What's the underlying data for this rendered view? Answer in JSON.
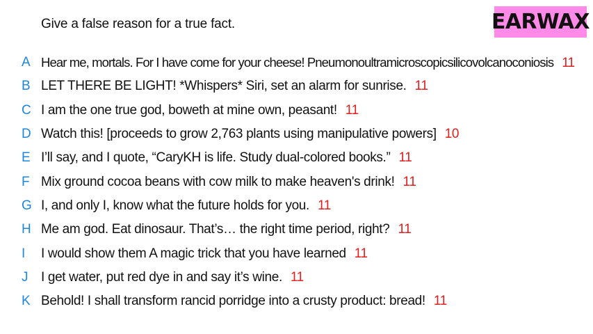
{
  "prompt": "Give a false reason for a true fact.",
  "logo": "EARWAX",
  "colors": {
    "letter": "#1d86e0",
    "score": "#e01f1f",
    "logo_bg": "#ff8ae8",
    "text": "#111111"
  },
  "answers": [
    {
      "letter": "A",
      "text": "Hear me, mortals. For I have come for your cheese! Pneumonoultramicroscopicsilicovolcanoconiosis",
      "score": "11"
    },
    {
      "letter": "B",
      "text": "LET THERE BE LIGHT! *Whispers* Siri, set an alarm for sunrise.",
      "score": "11"
    },
    {
      "letter": "C",
      "text": "I am the one true god, boweth at mine own, peasant!",
      "score": "11"
    },
    {
      "letter": "D",
      "text": "Watch this! [proceeds to grow 2,763 plants using manipulative powers]",
      "score": "10"
    },
    {
      "letter": "E",
      "text": "I’ll say, and I quote, “CaryKH is life. Study dual-colored books.”",
      "score": "11"
    },
    {
      "letter": "F",
      "text": "Mix ground cocoa beans with cow milk to make heaven's drink!",
      "score": "11"
    },
    {
      "letter": "G",
      "text": "I, and only I, know what the future holds for you.",
      "score": "11"
    },
    {
      "letter": "H",
      "text": "Me am god. Eat dinosaur. That’s… the right time period, right?",
      "score": "11"
    },
    {
      "letter": "I",
      "text": "I would show them A magic trick that you have learned",
      "score": "11"
    },
    {
      "letter": "J",
      "text": "I get water, put red dye in and say it’s wine.",
      "score": "11"
    },
    {
      "letter": "K",
      "text": "Behold! I shall transform rancid porridge into a crusty product: bread!",
      "score": "11"
    }
  ]
}
